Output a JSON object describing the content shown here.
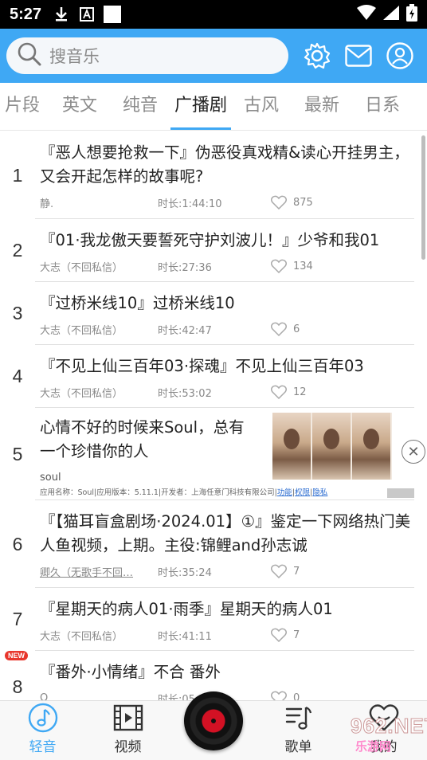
{
  "status": {
    "time": "5:27"
  },
  "header": {
    "search_placeholder": "搜音乐"
  },
  "tabs": [
    "片段",
    "英文",
    "纯音",
    "广播剧",
    "古风",
    "最新",
    "日系"
  ],
  "active_tab": 3,
  "items": [
    {
      "rank": "1",
      "title": "『恶人想要抢救一下』伪恶役真戏精&读心开挂男主，又会开起怎样的故事呢?",
      "author": "静.",
      "duration": "时长:1:44:10",
      "likes": "875"
    },
    {
      "rank": "2",
      "title": "『01·我龙傲天要誓死守护刘波儿！』少爷和我01",
      "author": "大志（不回私信）",
      "duration": "时长:27:36",
      "likes": "134"
    },
    {
      "rank": "3",
      "title": "『过桥米线10』过桥米线10",
      "author": "大志（不回私信）",
      "duration": "时长:42:47",
      "likes": "6"
    },
    {
      "rank": "4",
      "title": "『不见上仙三百年03·探魂』不见上仙三百年03",
      "author": "大志（不回私信）",
      "duration": "时长:53:02",
      "likes": "12"
    },
    {
      "rank": "6",
      "title": "『【猫耳盲盒剧场·2024.01】①』鉴定一下网络热门美人鱼视频，上期。主役:锦鲤and孙志诚",
      "author": "卿久（无歌手不回…",
      "duration": "时长:35:24",
      "likes": "7"
    },
    {
      "rank": "7",
      "title": "『星期天的病人01·雨季』星期天的病人01",
      "author": "大志（不回私信）",
      "duration": "时长:41:11",
      "likes": "7"
    },
    {
      "rank": "8",
      "title": "『番外·小情绪』不合 番外",
      "author": "Q",
      "duration": "时长:05:",
      "likes": "0",
      "badge": "NEW"
    }
  ],
  "ad": {
    "rank": "5",
    "text": "心情不好的时候来Soul，总有一个珍惜你的人",
    "brand": "soul",
    "fine_prefix": "应用名称：Soul|应用版本：5.11.1|开发者：上海任意门科技有限公司|",
    "fine_links": [
      "功能",
      "权限",
      "隐私"
    ]
  },
  "nav": [
    {
      "label": "轻音",
      "icon": "music-note-icon"
    },
    {
      "label": "视频",
      "icon": "film-icon"
    },
    {
      "label": "",
      "icon": "record-disc-icon"
    },
    {
      "label": "歌单",
      "icon": "playlist-icon"
    },
    {
      "label": "我的",
      "icon": "heart-face-icon"
    }
  ],
  "watermark": {
    "big": "962.NET",
    "small": "乐游网"
  },
  "colors": {
    "accent": "#3fa8f4",
    "badge": "#e8362c",
    "disc_center": "#d31124"
  }
}
